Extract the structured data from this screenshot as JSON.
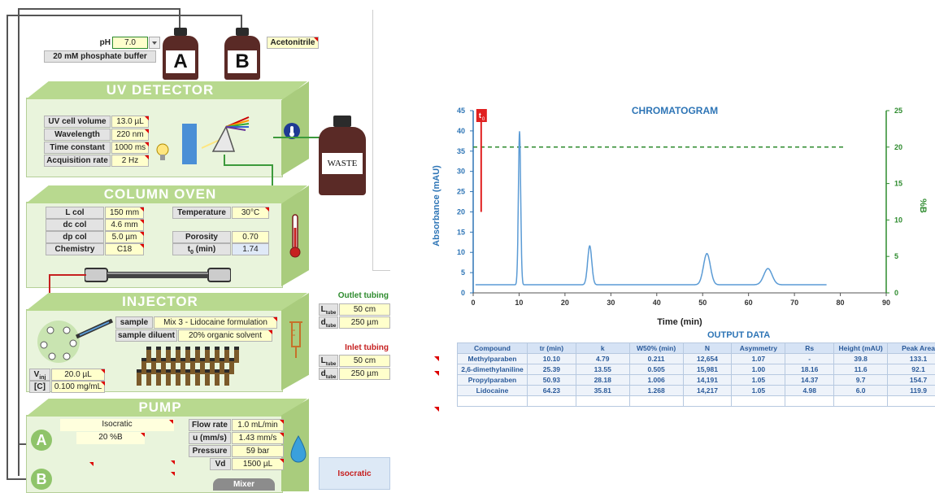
{
  "bottles": {
    "a_letter": "A",
    "b_letter": "B",
    "waste_label": "WASTE"
  },
  "mobile_phase": {
    "ph_label": "pH",
    "ph_value": "7.0",
    "buffer_label": "20 mM phosphate buffer",
    "organic_label": "Acetonitrile"
  },
  "uv_detector": {
    "title": "UV DETECTOR",
    "rows": [
      {
        "label": "UV cell volume",
        "value": "13.0 µL"
      },
      {
        "label": "Wavelength",
        "value": "220 nm"
      },
      {
        "label": "Time constant",
        "value": "1000 ms"
      },
      {
        "label": "Acquisition rate",
        "value": "2 Hz"
      }
    ]
  },
  "column_oven": {
    "title": "COLUMN OVEN",
    "left_rows": [
      {
        "label": "L col",
        "value": "150 mm"
      },
      {
        "label": "dc col",
        "value": "4.6 mm"
      },
      {
        "label": "dp col",
        "value": "5.0 µm"
      },
      {
        "label": "Chemistry",
        "value": "C18"
      }
    ],
    "temperature_label": "Temperature",
    "temperature_value": "30°C",
    "porosity_label": "Porosity",
    "porosity_value": "0.70",
    "t0_label": "t",
    "t0_sub": "0",
    "t0_suffix": " (min)",
    "t0_value": "1.74"
  },
  "injector": {
    "title": "INJECTOR",
    "sample_label": "sample",
    "sample_value": "Mix 3 - Lidocaine formulation",
    "diluent_label": "sample diluent",
    "diluent_value": "20% organic solvent",
    "vinj_label": "V",
    "vinj_sub": "inj",
    "vinj_value": "20.0 µL",
    "conc_label": "[C]",
    "conc_value": "0.100 mg/mL"
  },
  "pump": {
    "title": "PUMP",
    "mode_value": "Isocratic",
    "percent_b_value": "20 %B",
    "flow_label": "Flow rate",
    "flow_value": "1.0 mL/min",
    "u_label": "u (mm/s)",
    "u_value": "1.43 mm/s",
    "pressure_label": "Pressure",
    "pressure_value": "59 bar",
    "vd_label": "Vd",
    "vd_value": "1500 µL",
    "channel_a": "A",
    "channel_b": "B",
    "mixer_label": "Mixer"
  },
  "outlet_tubing": {
    "title": "Outlet tubing",
    "l_label": "L",
    "l_sub": "tube",
    "l_value": "50 cm",
    "d_label": "d",
    "d_sub": "tube",
    "d_value": "250 µm"
  },
  "inlet_tubing": {
    "title": "Inlet tubing",
    "l_label": "L",
    "l_sub": "tube",
    "l_value": "50 cm",
    "d_label": "d",
    "d_sub": "tube",
    "d_value": "250 µm"
  },
  "gradient_mode_button": "Isocratic",
  "colors": {
    "module_bg": "#e9f4dc",
    "module_top": "#b8d98f",
    "chart_line": "#5b9bd5",
    "axis_green": "#2e8b2e",
    "t0_red": "#e02020",
    "title_blue": "#2e75b6"
  },
  "chart_data": {
    "type": "line",
    "title": "CHROMATOGRAM",
    "xlabel": "Time (min)",
    "ylabel": "Absorbance (mAU)",
    "y2label": "%B",
    "xlim": [
      0,
      90
    ],
    "ylim": [
      0,
      45
    ],
    "y2lim": [
      0,
      25
    ],
    "x_ticks": [
      0,
      10,
      20,
      30,
      40,
      50,
      60,
      70,
      80,
      90
    ],
    "y_ticks": [
      0,
      5,
      10,
      15,
      20,
      25,
      30,
      35,
      40,
      45
    ],
    "y2_ticks": [
      0,
      5,
      10,
      15,
      20,
      25
    ],
    "t0_marker": {
      "label": "t",
      "sub": "0",
      "x": 1.74
    },
    "percent_b_line": {
      "value": 20,
      "style": "dashed"
    },
    "baseline": 2,
    "x_end": 77,
    "peaks": [
      {
        "x": 10.1,
        "height": 39.8,
        "sigma": 0.25
      },
      {
        "x": 25.39,
        "height": 11.6,
        "sigma": 0.45
      },
      {
        "x": 50.93,
        "height": 9.7,
        "sigma": 0.75
      },
      {
        "x": 64.23,
        "height": 6.0,
        "sigma": 0.9
      }
    ],
    "grid": false
  },
  "output_table": {
    "title": "OUTPUT DATA",
    "headers": [
      "Compound",
      "tr (min)",
      "k",
      "W50% (min)",
      "N",
      "Asymmetry",
      "Rs",
      "Height (mAU)",
      "Peak Area"
    ],
    "rows": [
      [
        "Methylparaben",
        "10.10",
        "4.79",
        "0.211",
        "12,654",
        "1.07",
        "-",
        "39.8",
        "133.1"
      ],
      [
        "2,6-dimethylaniline",
        "25.39",
        "13.55",
        "0.505",
        "15,981",
        "1.00",
        "18.16",
        "11.6",
        "92.1"
      ],
      [
        "Propylparaben",
        "50.93",
        "28.18",
        "1.006",
        "14,191",
        "1.05",
        "14.37",
        "9.7",
        "154.7"
      ],
      [
        "Lidocaine",
        "64.23",
        "35.81",
        "1.268",
        "14,217",
        "1.05",
        "4.98",
        "6.0",
        "119.9"
      ]
    ]
  }
}
